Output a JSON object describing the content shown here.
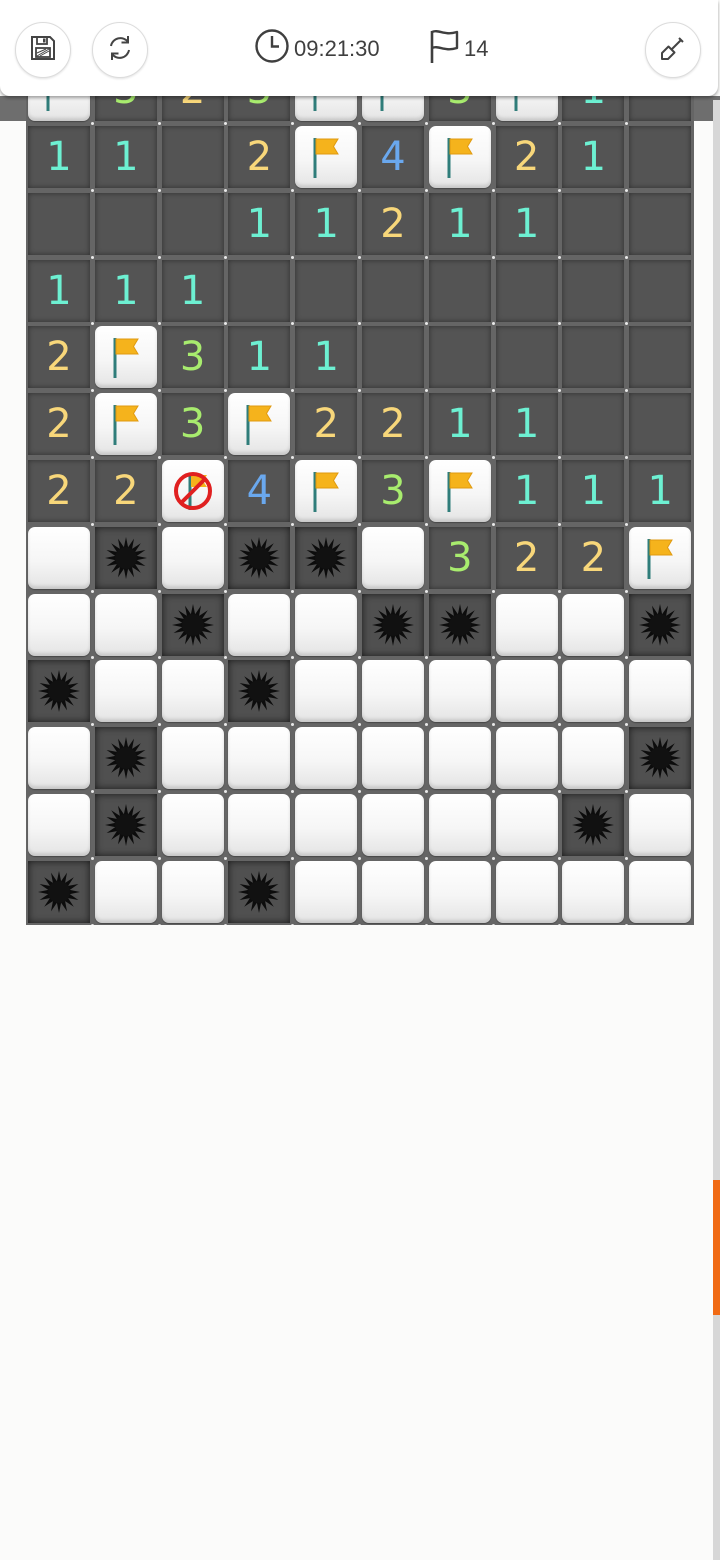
{
  "header": {
    "save_icon": "floppy-disk-icon",
    "restart_icon": "refresh-icon",
    "timer_icon": "clock-icon",
    "timer": "09:21:30",
    "flag_icon": "flag-outline-icon",
    "flags_count": "14",
    "dig_icon": "shovel-icon"
  },
  "board": {
    "cols": 10,
    "legend": {
      "C": "closed",
      "F": "flag",
      "X": "wrong-flag",
      "M": "mine",
      "0": "empty",
      "1-8": "number"
    },
    "partial_top_row": [
      "F",
      "3",
      "2",
      "3",
      "F",
      "F",
      "3",
      "F",
      "1",
      "0"
    ],
    "rows": [
      [
        "1",
        "1",
        "0",
        "2",
        "F",
        "4",
        "F",
        "2",
        "1",
        "0"
      ],
      [
        "0",
        "0",
        "0",
        "1",
        "1",
        "2",
        "1",
        "1",
        "0",
        "0"
      ],
      [
        "1",
        "1",
        "1",
        "0",
        "0",
        "0",
        "0",
        "0",
        "0",
        "0"
      ],
      [
        "2",
        "F",
        "3",
        "1",
        "1",
        "0",
        "0",
        "0",
        "0",
        "0"
      ],
      [
        "2",
        "F",
        "3",
        "F",
        "2",
        "2",
        "1",
        "1",
        "0",
        "0"
      ],
      [
        "2",
        "2",
        "X",
        "4",
        "F",
        "3",
        "F",
        "1",
        "1",
        "1"
      ],
      [
        "C",
        "M",
        "C",
        "M",
        "M",
        "C",
        "3",
        "2",
        "2",
        "F"
      ],
      [
        "C",
        "C",
        "M",
        "C",
        "C",
        "M",
        "M",
        "C",
        "C",
        "M"
      ],
      [
        "M",
        "C",
        "C",
        "M",
        "C",
        "C",
        "C",
        "C",
        "C",
        "C"
      ],
      [
        "C",
        "M",
        "C",
        "C",
        "C",
        "C",
        "C",
        "C",
        "C",
        "M"
      ],
      [
        "C",
        "M",
        "C",
        "C",
        "C",
        "C",
        "C",
        "C",
        "M",
        "C"
      ],
      [
        "M",
        "C",
        "C",
        "M",
        "C",
        "C",
        "C",
        "C",
        "C",
        "C"
      ]
    ]
  },
  "colors": {
    "n1": "#6df0d2",
    "n2": "#f8d77a",
    "n3": "#a8ec6e",
    "n4": "#6aa8ee",
    "flag": "#f5b31c",
    "accent_scrollbar": "#f06a14"
  }
}
